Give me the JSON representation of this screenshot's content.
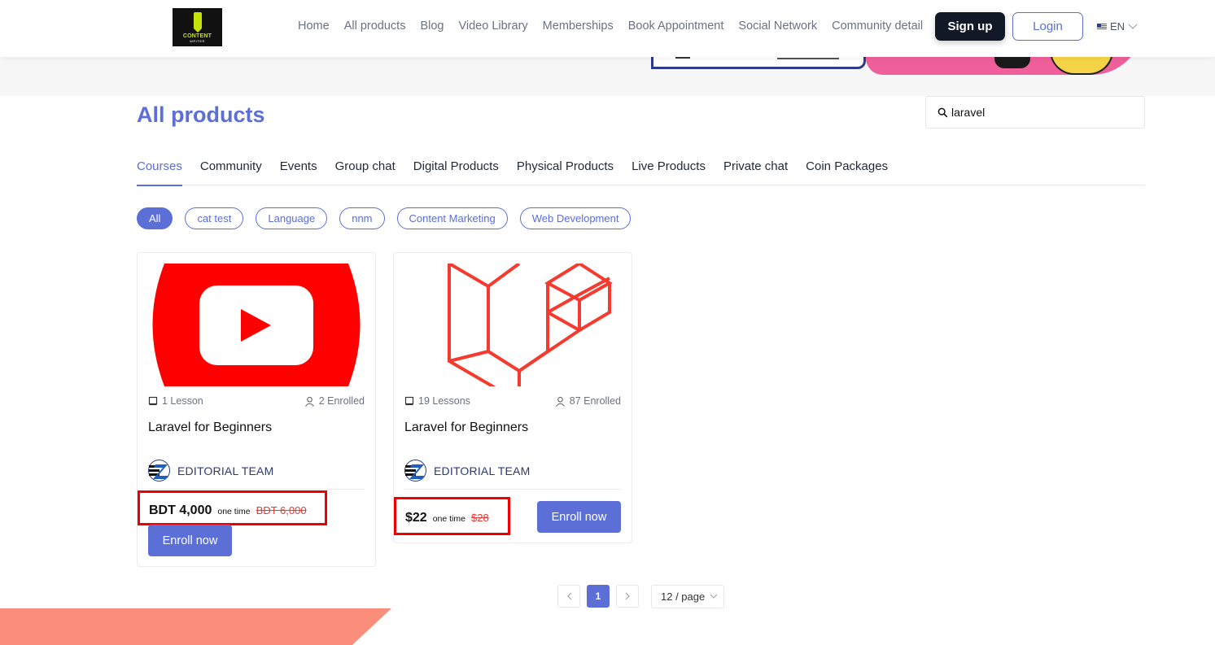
{
  "header": {
    "logo_line1": "CONTENT",
    "logo_line2": "WRITER",
    "nav": [
      "Home",
      "All products",
      "Blog",
      "Video Library",
      "Memberships",
      "Book Appointment",
      "Social Network",
      "Community detail"
    ],
    "signup_label": "Sign up",
    "login_label": "Login",
    "language": "EN"
  },
  "main": {
    "title": "All products",
    "search": {
      "value": "laravel"
    },
    "tabs": [
      "Courses",
      "Community",
      "Events",
      "Group chat",
      "Digital Products",
      "Physical Products",
      "Live Products",
      "Private chat",
      "Coin Packages"
    ],
    "active_tab": "Courses",
    "categories": [
      "All",
      "cat test",
      "Language",
      "nnm",
      "Content Marketing",
      "Web Development"
    ],
    "active_category": "All"
  },
  "products": [
    {
      "lessons": "1 Lesson",
      "enrolled": "2 Enrolled",
      "title": "Laravel for Beginners",
      "author": "EDITORIAL TEAM",
      "price": "BDT 4,000",
      "billing": "one time",
      "old_price": "BDT 6,000",
      "enroll_label": "Enroll now",
      "thumbnail_icon": "youtube-play-icon"
    },
    {
      "lessons": "19 Lessons",
      "enrolled": "87 Enrolled",
      "title": "Laravel for Beginners",
      "author": "EDITORIAL TEAM",
      "price": "$22",
      "billing": "one time",
      "old_price": "$28",
      "enroll_label": "Enroll now",
      "thumbnail_icon": "laravel-logo-icon"
    }
  ],
  "pagination": {
    "current_page": "1",
    "per_page": "12 / page"
  },
  "colors": {
    "accent": "#5b6fd6",
    "highlight": "#ee0000",
    "youtube_red": "#ff0000",
    "laravel_red": "#f53a2f"
  }
}
